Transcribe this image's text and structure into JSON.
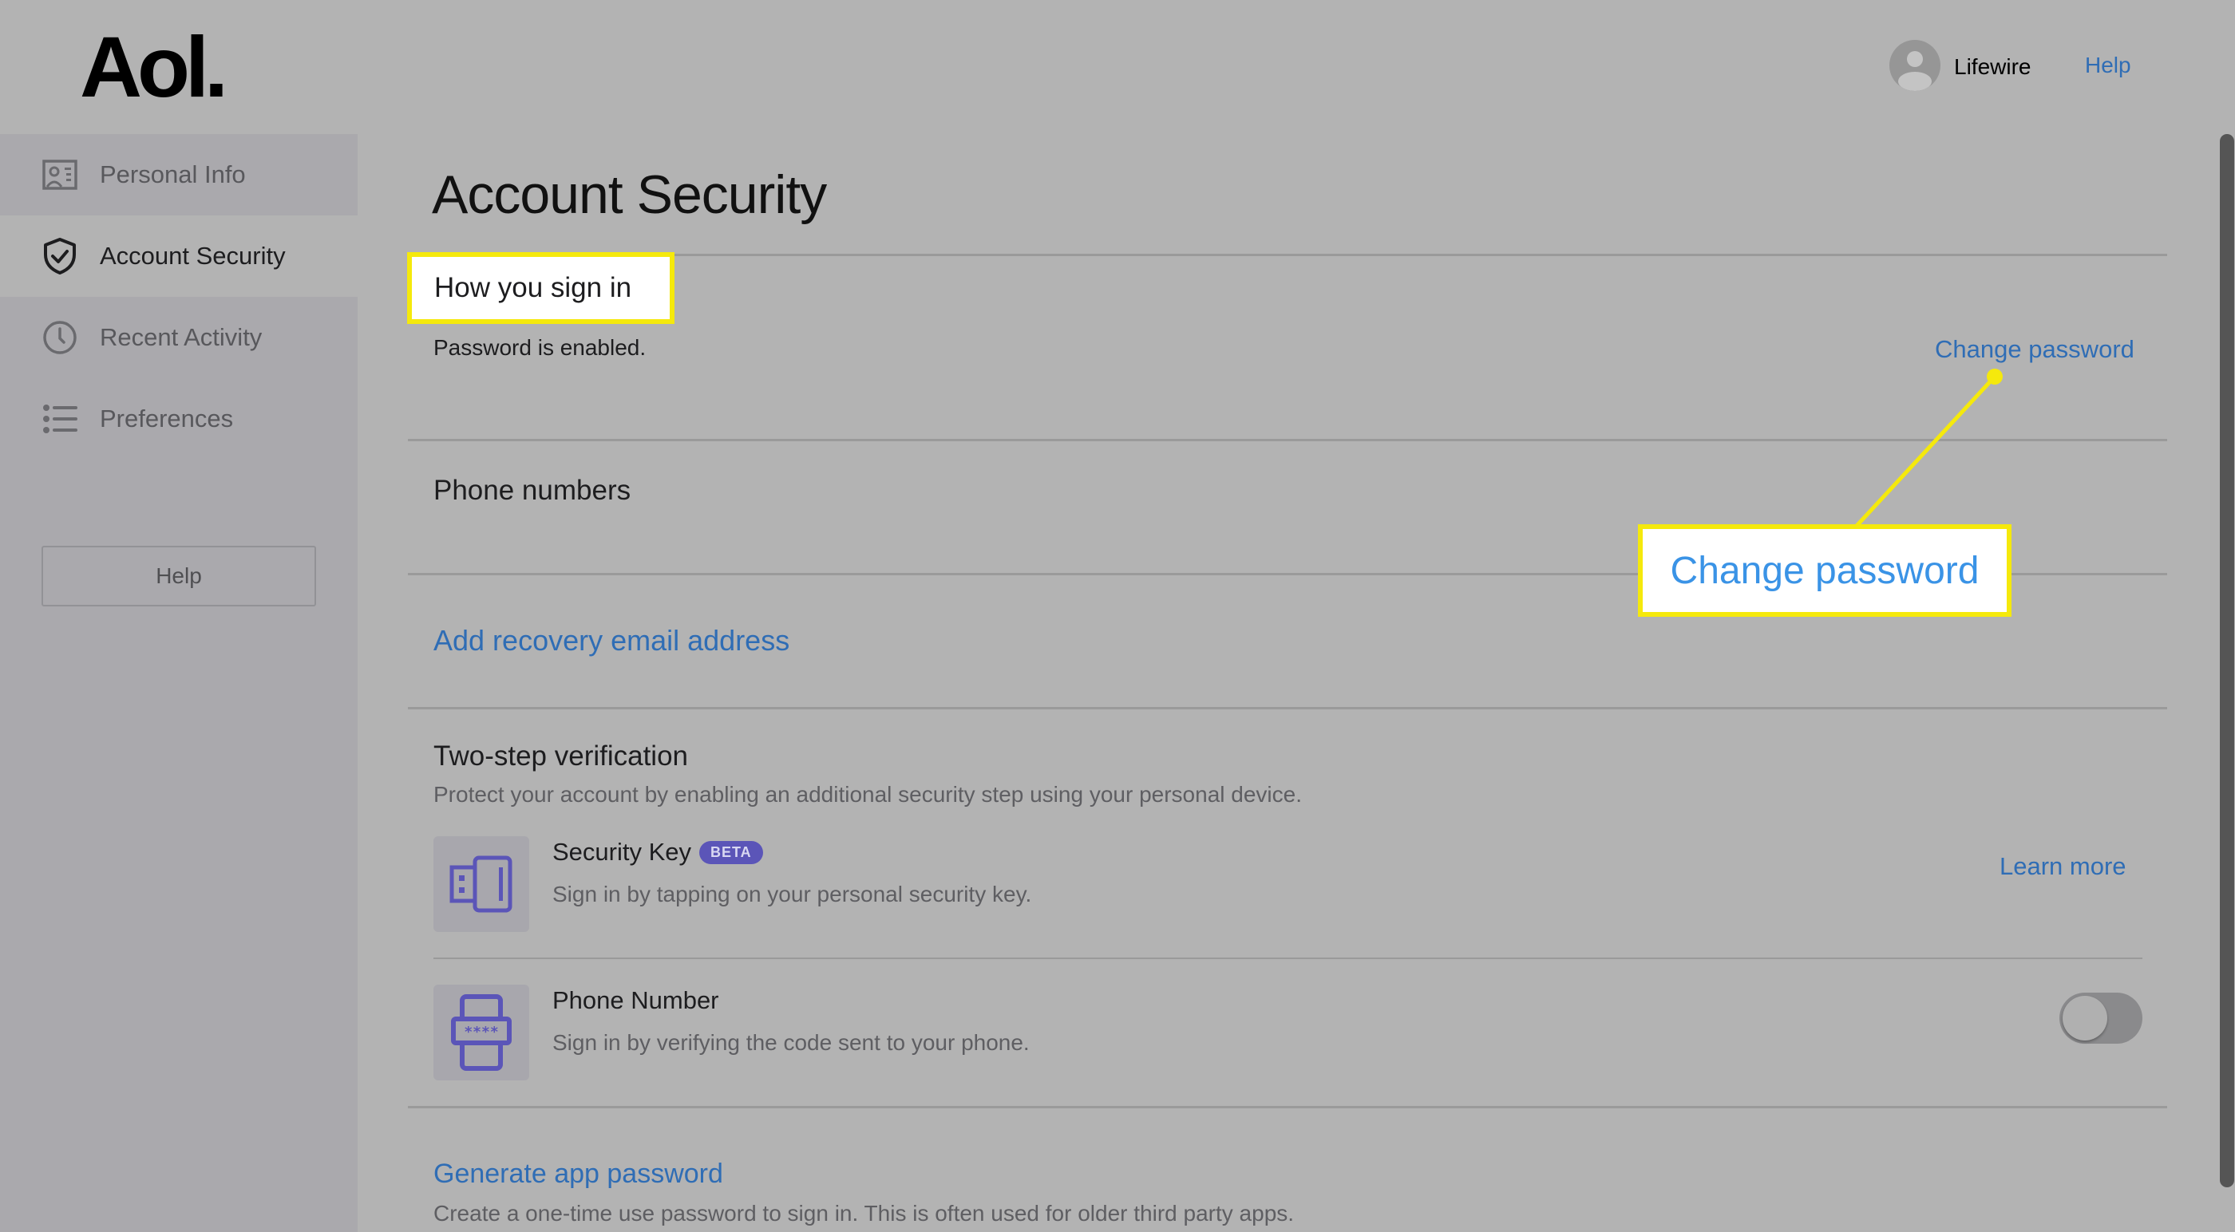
{
  "brand": {
    "logo_text": "Aol."
  },
  "header": {
    "user_name": "Lifewire",
    "help_label": "Help"
  },
  "sidebar": {
    "items": [
      {
        "label": "Personal Info",
        "icon": "id-card-icon",
        "active": false
      },
      {
        "label": "Account Security",
        "icon": "shield-check-icon",
        "active": true
      },
      {
        "label": "Recent Activity",
        "icon": "clock-icon",
        "active": false
      },
      {
        "label": "Preferences",
        "icon": "list-icon",
        "active": false
      }
    ],
    "help_button_label": "Help"
  },
  "main": {
    "title": "Account Security",
    "sign_in": {
      "heading": "How you sign in",
      "status": "Password is enabled.",
      "change_password_label": "Change password"
    },
    "phone_numbers": {
      "heading": "Phone numbers"
    },
    "recovery_email": {
      "link_label": "Add recovery email address"
    },
    "two_step": {
      "heading": "Two-step verification",
      "description": "Protect your account by enabling an additional security step using your personal device.",
      "methods": [
        {
          "title": "Security Key",
          "badge": "BETA",
          "description": "Sign in by tapping on your personal security key.",
          "action_label": "Learn more",
          "icon": "usb-key-icon"
        },
        {
          "title": "Phone Number",
          "description": "Sign in by verifying the code sent to your phone.",
          "toggle_on": false,
          "icon": "phone-code-icon",
          "icon_code_text": "****"
        }
      ]
    },
    "app_password": {
      "link_label": "Generate app password",
      "description": "Create a one-time use password to sign in. This is often used for older third party apps."
    }
  },
  "annotation": {
    "callout_text": "Change password",
    "highlight_color": "#f5e90c"
  },
  "colors": {
    "link": "#2f6db5",
    "callout_text": "#3a93e6",
    "icon_accent": "#5b55b8",
    "page_bg": "#b3b3b3",
    "sidebar_bg": "#aaa9ad"
  }
}
